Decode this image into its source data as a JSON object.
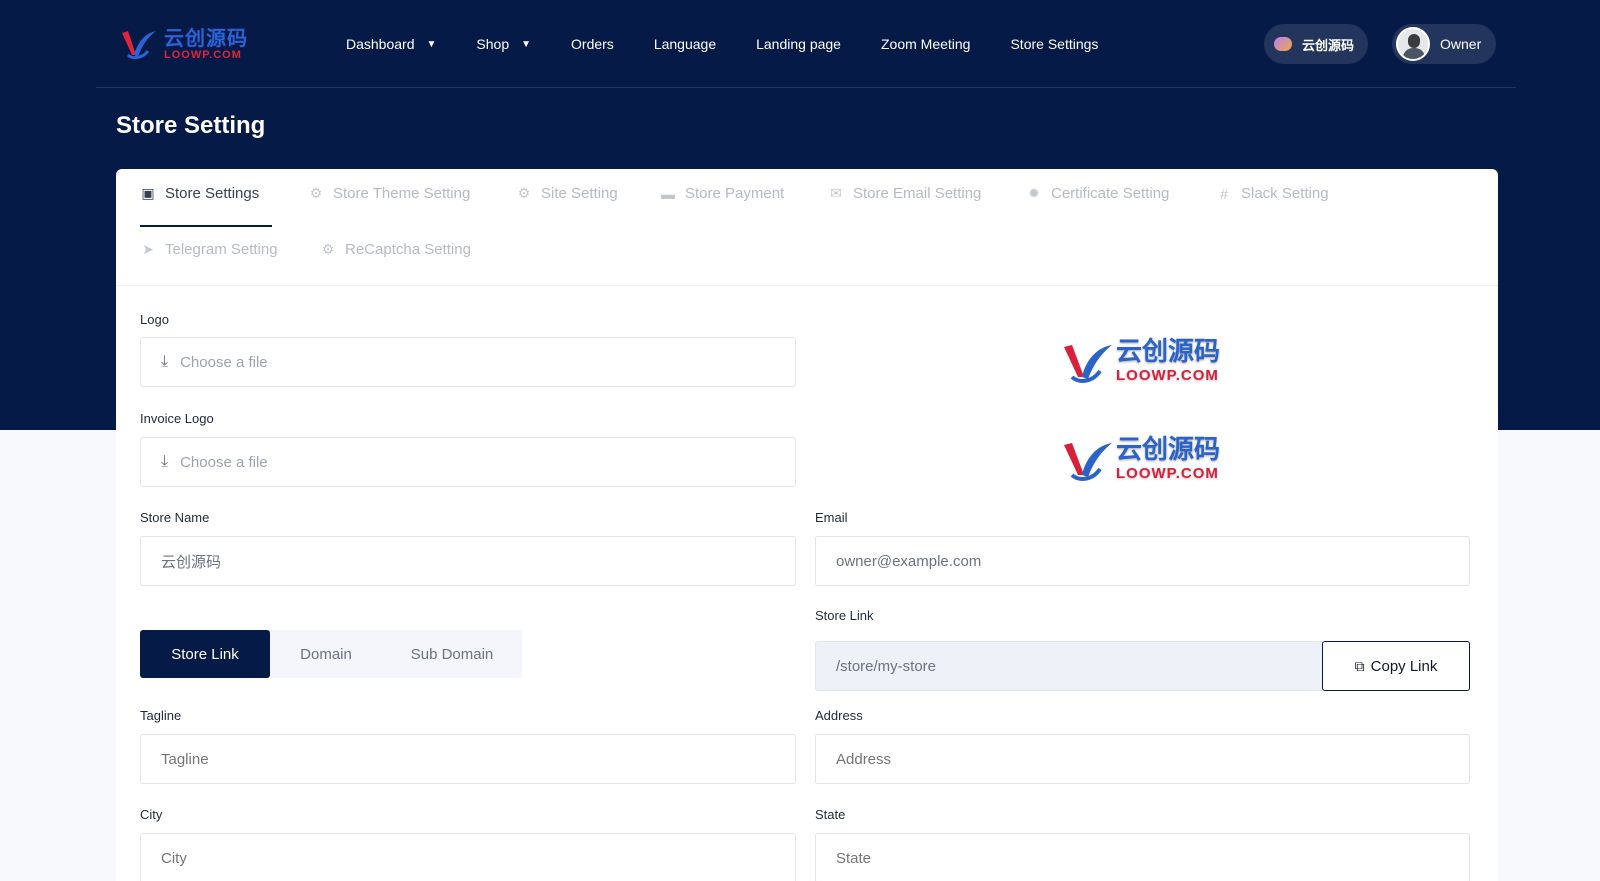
{
  "nav": {
    "brand_cn": "云创源码",
    "brand_en": "LOOWP.COM",
    "items": [
      {
        "label": "Dashboard",
        "caret": true
      },
      {
        "label": "Shop",
        "caret": true
      },
      {
        "label": "Orders",
        "caret": false
      },
      {
        "label": "Language",
        "caret": false
      },
      {
        "label": "Landing page",
        "caret": false
      },
      {
        "label": "Zoom Meeting",
        "caret": false
      },
      {
        "label": "Store Settings",
        "caret": false
      }
    ],
    "workspace_label": "云创源码",
    "user_label": "Owner"
  },
  "page": {
    "title": "Store Setting"
  },
  "tabs": [
    {
      "label": "Store Settings",
      "icon": "store-icon",
      "active": true
    },
    {
      "label": "Store Theme Setting",
      "icon": "gear-icon",
      "active": false
    },
    {
      "label": "Site Setting",
      "icon": "gear-icon",
      "active": false
    },
    {
      "label": "Store Payment",
      "icon": "money-icon",
      "active": false
    },
    {
      "label": "Store Email Setting",
      "icon": "envelope-icon",
      "active": false
    },
    {
      "label": "Certificate Setting",
      "icon": "badge-icon",
      "active": false
    },
    {
      "label": "Slack Setting",
      "icon": "slack-icon",
      "active": false
    },
    {
      "label": "Telegram Setting",
      "icon": "paper-plane-icon",
      "active": false
    },
    {
      "label": "ReCaptcha Setting",
      "icon": "gear-icon",
      "active": false
    }
  ],
  "form": {
    "logo_label": "Logo",
    "logo_file_text": "Choose a file",
    "invoice_logo_label": "Invoice Logo",
    "invoice_logo_file_text": "Choose a file",
    "preview_cn": "云创源码",
    "preview_en": "LOOWP.COM",
    "store_name_label": "Store Name",
    "store_name_value": "云创源码",
    "email_label": "Email",
    "email_value": "owner@example.com",
    "link_types": [
      "Store Link",
      "Domain",
      "Sub Domain"
    ],
    "store_link_label": "Store Link",
    "store_link_value": "/store/my-store",
    "copy_link_label": "Copy Link",
    "tagline_label": "Tagline",
    "tagline_placeholder": "Tagline",
    "address_label": "Address",
    "address_placeholder": "Address",
    "city_label": "City",
    "city_placeholder": "City",
    "state_label": "State",
    "state_placeholder": "State"
  },
  "colors": {
    "navy": "#061a47",
    "brand_blue": "#2b63d9",
    "brand_red": "#e0243b"
  }
}
